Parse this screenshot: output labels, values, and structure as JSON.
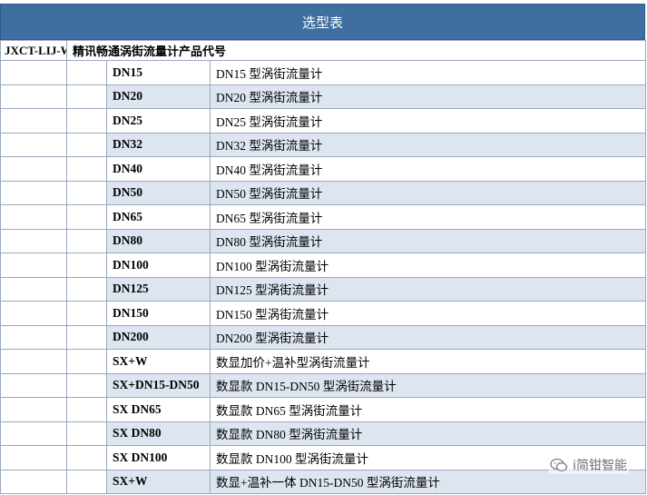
{
  "title": "选型表",
  "header": {
    "model_prefix": "JXCT-LIJ-WJ",
    "code_title": "精讯畅通涡街流量计产品代号"
  },
  "rows": [
    {
      "code": "DN15",
      "desc": "DN15 型涡街流量计"
    },
    {
      "code": "DN20",
      "desc": "DN20 型涡街流量计"
    },
    {
      "code": "DN25",
      "desc": "DN25 型涡街流量计"
    },
    {
      "code": "DN32",
      "desc": "DN32 型涡街流量计"
    },
    {
      "code": "DN40",
      "desc": "DN40 型涡街流量计"
    },
    {
      "code": "DN50",
      "desc": "DN50 型涡街流量计"
    },
    {
      "code": "DN65",
      "desc": "DN65 型涡街流量计"
    },
    {
      "code": "DN80",
      "desc": "DN80 型涡街流量计"
    },
    {
      "code": "DN100",
      "desc": "DN100 型涡街流量计"
    },
    {
      "code": "DN125",
      "desc": "DN125 型涡街流量计"
    },
    {
      "code": "DN150",
      "desc": "DN150 型涡街流量计"
    },
    {
      "code": "DN200",
      "desc": "DN200 型涡街流量计"
    },
    {
      "code": "SX+W",
      "desc": "数显加价+温补型涡街流量计"
    },
    {
      "code": "SX+DN15-DN50",
      "desc": "数显款 DN15-DN50 型涡街流量计"
    },
    {
      "code": "SX DN65",
      "desc": "数显款 DN65  型涡街流量计"
    },
    {
      "code": "SX DN80",
      "desc": "数显款 DN80  型涡街流量计"
    },
    {
      "code": "SX DN100",
      "desc": "数显款 DN100  型涡街流量计"
    },
    {
      "code": "SX+W",
      "desc": "数显+温补一体 DN15-DN50  型涡街流量计"
    }
  ],
  "watermark": {
    "text": "i简钳智能",
    "icon": "wechat-icon"
  },
  "colors": {
    "title_bg": "#3f6fa0",
    "row_shade": "#dde5f0",
    "border": "#9aa9bd"
  }
}
